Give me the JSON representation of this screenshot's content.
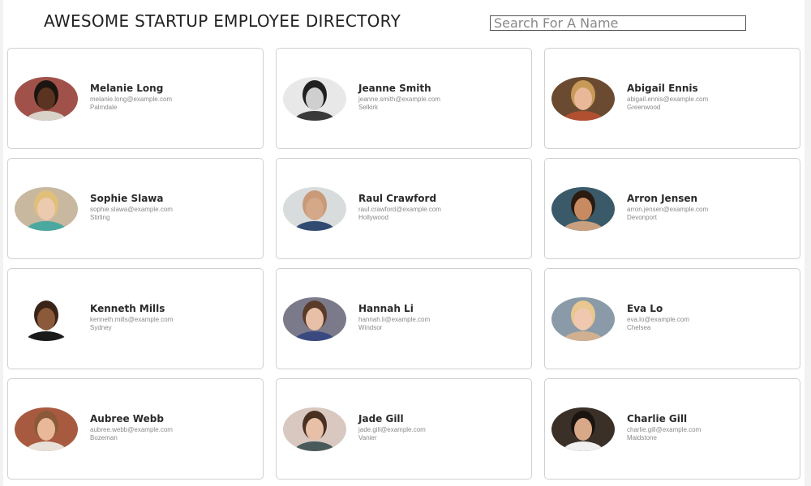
{
  "header": {
    "title": "AWESOME STARTUP EMPLOYEE DIRECTORY",
    "search_placeholder": "Search For A Name"
  },
  "employees": [
    {
      "name": "Melanie Long",
      "email": "melanie.long@example.com",
      "city": "Palmdale",
      "avatar": {
        "bg": "#a0524a",
        "skin": "#5a3420",
        "hair": "#1c1410",
        "shirt": "#d8d2c8"
      }
    },
    {
      "name": "Jeanne Smith",
      "email": "jeanne.smith@example.com",
      "city": "Selkirk",
      "avatar": {
        "bg": "#e8e8e8",
        "skin": "#cfcfcf",
        "hair": "#202020",
        "shirt": "#3a3a3a"
      }
    },
    {
      "name": "Abigail Ennis",
      "email": "abigail.ennis@example.com",
      "city": "Greenwood",
      "avatar": {
        "bg": "#6a4a30",
        "skin": "#e8b898",
        "hair": "#c89a58",
        "shirt": "#b05030"
      }
    },
    {
      "name": "Sophie Slawa",
      "email": "sophie.slawa@example.com",
      "city": "Stirling",
      "avatar": {
        "bg": "#c8b8a0",
        "skin": "#eccab0",
        "hair": "#e0c078",
        "shirt": "#4aa8a0"
      }
    },
    {
      "name": "Raul Crawford",
      "email": "raul.crawford@example.com",
      "city": "Hollywood",
      "avatar": {
        "bg": "#d8dcdc",
        "skin": "#d4a888",
        "hair": "#c89a78",
        "shirt": "#304a70"
      }
    },
    {
      "name": "Arron Jensen",
      "email": "arron.jensen@example.com",
      "city": "Devonport",
      "avatar": {
        "bg": "#3a5a6a",
        "skin": "#c88a60",
        "hair": "#2a1a10",
        "shirt": "#c8a080"
      }
    },
    {
      "name": "Kenneth Mills",
      "email": "kenneth.mills@example.com",
      "city": "Sydney",
      "avatar": {
        "bg": "#ffffff",
        "skin": "#8a5a3a",
        "hair": "#3a2418",
        "shirt": "#1a1a1a"
      }
    },
    {
      "name": "Hannah Li",
      "email": "hannah.li@example.com",
      "city": "Windsor",
      "avatar": {
        "bg": "#7a7a8a",
        "skin": "#e8c0a8",
        "hair": "#5a3a28",
        "shirt": "#3a4a80"
      }
    },
    {
      "name": "Eva Lo",
      "email": "eva.lo@example.com",
      "city": "Chelsea",
      "avatar": {
        "bg": "#8a9aa8",
        "skin": "#f0c8b0",
        "hair": "#e8c890",
        "shirt": "#d0b090"
      }
    },
    {
      "name": "Aubree Webb",
      "email": "aubree.webb@example.com",
      "city": "Bozeman",
      "avatar": {
        "bg": "#a85a40",
        "skin": "#e8b898",
        "hair": "#8a5a38",
        "shirt": "#e8e0d8"
      }
    },
    {
      "name": "Jade Gill",
      "email": "jade.gill@example.com",
      "city": "Vanier",
      "avatar": {
        "bg": "#d8c8c0",
        "skin": "#e8c0a8",
        "hair": "#4a3020",
        "shirt": "#4a5a5a"
      }
    },
    {
      "name": "Charlie Gill",
      "email": "charlie.gill@example.com",
      "city": "Maidstone",
      "avatar": {
        "bg": "#3a3028",
        "skin": "#d8a888",
        "hair": "#1a1410",
        "shirt": "#f0f0f0"
      }
    }
  ]
}
